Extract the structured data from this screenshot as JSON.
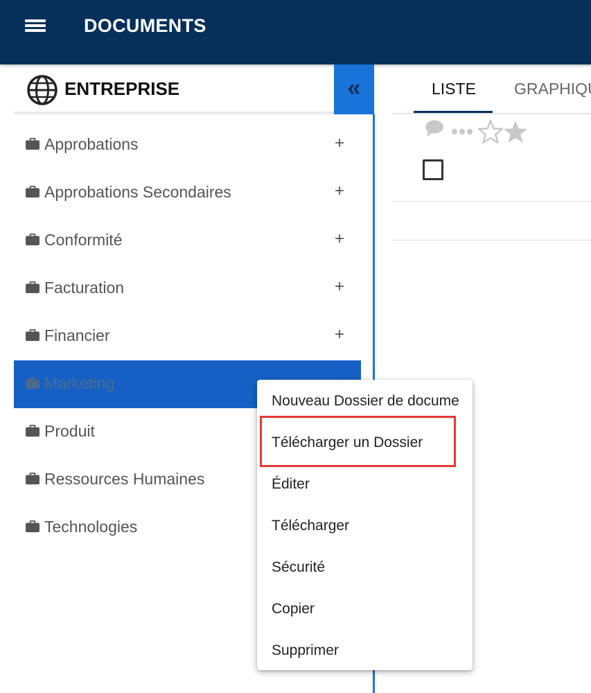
{
  "appbar": {
    "title": "DOCUMENTS",
    "menu_icon": "hamburger-menu-icon"
  },
  "panel": {
    "title": "ENTREPRISE",
    "title_icon": "globe-icon",
    "collapse_label": "«",
    "items": [
      {
        "label": "Approbations",
        "expand": "+"
      },
      {
        "label": "Approbations Secondaires",
        "expand": "+"
      },
      {
        "label": "Conformité",
        "expand": "+"
      },
      {
        "label": "Facturation",
        "expand": "+"
      },
      {
        "label": "Financier",
        "expand": "+"
      },
      {
        "label": "Marketing",
        "selected": true
      },
      {
        "label": "Produit"
      },
      {
        "label": "Ressources Humaines"
      },
      {
        "label": "Technologies"
      }
    ]
  },
  "tabs": {
    "list": "LISTE",
    "graph": "GRAPHIQU"
  },
  "toolbar_icons": [
    "chat-bubble-icon",
    "more-dots-icon",
    "star-outline-icon",
    "star-solid-icon"
  ],
  "context_menu": {
    "items": [
      "Nouveau Dossier de docume",
      "Télécharger un Dossier",
      "Éditer",
      "Télécharger",
      "Sécurité",
      "Copier",
      "Supprimer"
    ],
    "highlighted_index": 1
  },
  "colors": {
    "appbar": "#06305a",
    "accent": "#1a73d9",
    "selected_row": "#1660c5",
    "highlight_border": "#e53935"
  }
}
